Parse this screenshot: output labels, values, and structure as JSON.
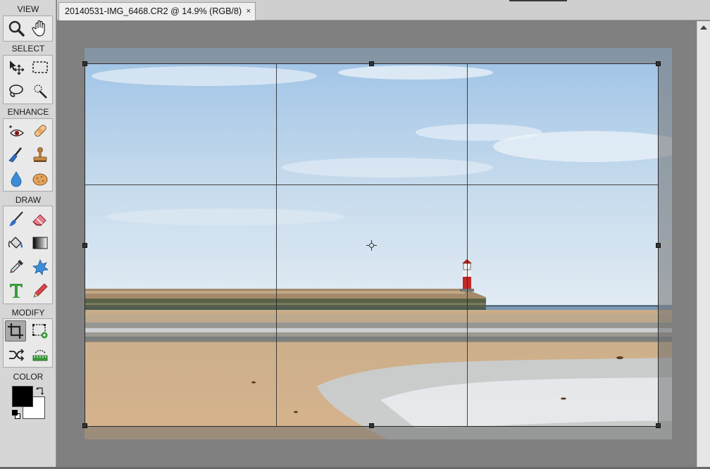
{
  "toolbox": {
    "sections": {
      "view": "VIEW",
      "select": "SELECT",
      "enhance": "ENHANCE",
      "draw": "DRAW",
      "modify": "MODIFY",
      "color": "COLOR"
    },
    "selected_tool": "crop-tool",
    "foreground_color": "#000000",
    "background_color": "#ffffff"
  },
  "document": {
    "tab_title": "20140531-IMG_6468.CR2 @ 14.9% (RGB/8)",
    "close_glyph": "×"
  },
  "colors": {
    "toolbox_bg": "#d6d6d6",
    "workspace_bg": "#808080",
    "crop_shield": "#6e6e6e"
  }
}
